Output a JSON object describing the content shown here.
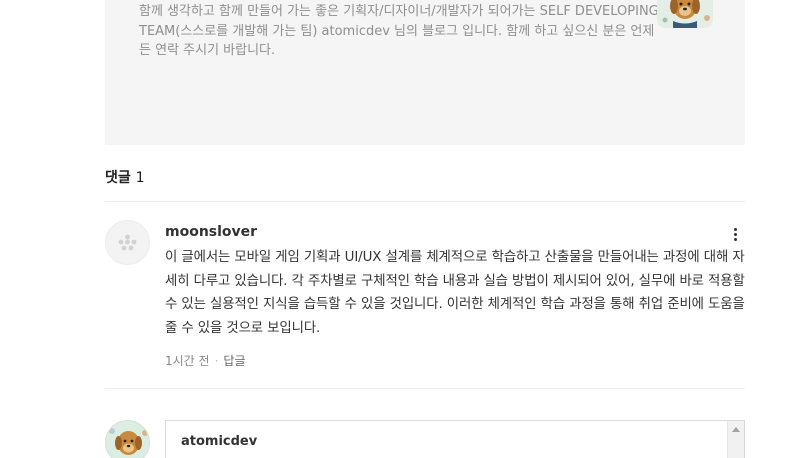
{
  "profile": {
    "description": "함께 생각하고 함께 만들어 가는 좋은 기획자/디자이너/개발자가 되어가는 SELF DEVELOPING TEAM(스스로를 개발해 가는 팀) atomicdev 님의 블로그 입니다. 함께 하고 싶으신 분은 언제든 연락 주시기 바랍니다.",
    "avatar_icon": "dog-portrait-avatar"
  },
  "comments_section": {
    "label": "댓글",
    "count": "1"
  },
  "comment": {
    "author": "moonslover",
    "avatar_icon": "default-user-avatar",
    "menu_icon": "more-vertical-icon",
    "body": "이 글에서는 모바일 게임 기획과 UI/UX 설계를 체계적으로 학습하고 산출물을 만들어내는 과정에 대해 자세히 다루고 있습니다. 각 주차별로 구체적인 학습 내용과 실습 방법이 제시되어 있어, 실무에 바로 적용할 수 있는 실용적인 지식을 습득할 수 있을 것입니다. 이러한 체계적인 학습 과정을 통해 취업 준비에 도움을 줄 수 있을 것으로 보입니다.",
    "time": "1시간 전",
    "reply_label": "답글"
  },
  "reply_form": {
    "author": "atomicdev",
    "avatar_icon": "dog-portrait-avatar"
  },
  "colors": {
    "card_bg": "#f5f5f5",
    "muted_text": "#8f8f8f",
    "body_text": "#333333",
    "divider": "#ececec"
  }
}
